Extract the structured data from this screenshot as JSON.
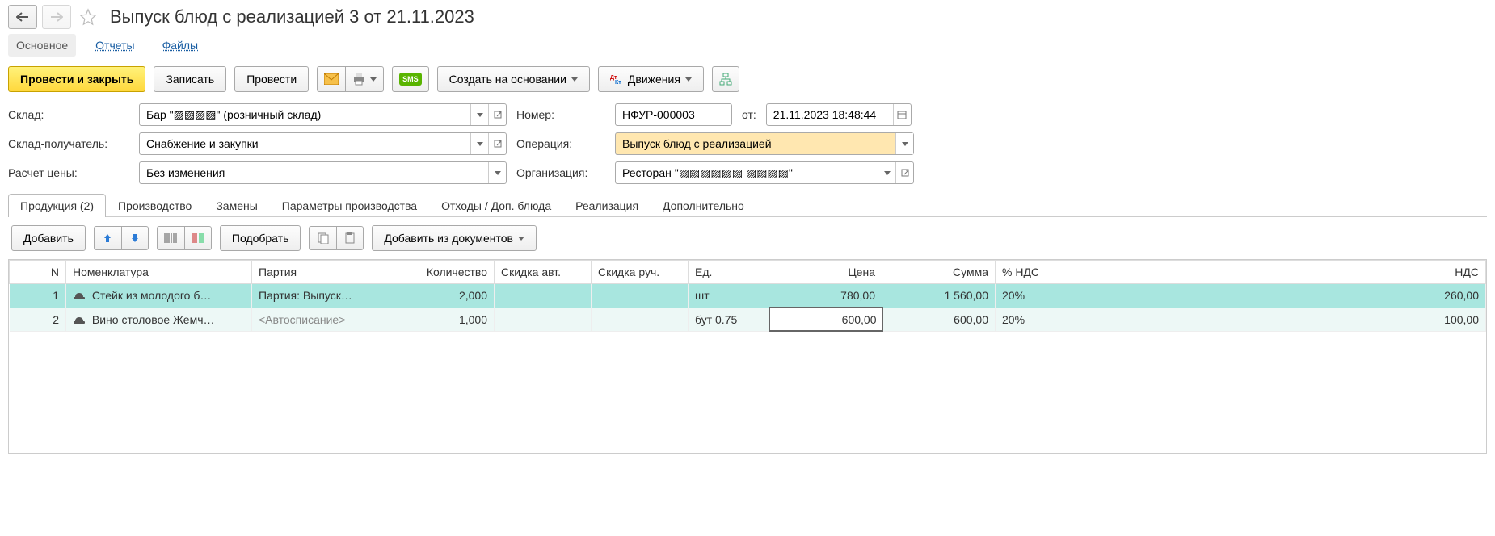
{
  "title": "Выпуск блюд с реализацией 3 от 21.11.2023",
  "nav": {
    "main": "Основное",
    "reports": "Отчеты",
    "files": "Файлы"
  },
  "toolbar": {
    "post_close": "Провести и закрыть",
    "save": "Записать",
    "post": "Провести",
    "create_based": "Создать на основании",
    "movements": "Движения"
  },
  "labels": {
    "warehouse": "Склад:",
    "warehouse_recv": "Склад-получатель:",
    "price_calc": "Расчет цены:",
    "number": "Номер:",
    "from": "от:",
    "operation": "Операция:",
    "organization": "Организация:"
  },
  "fields": {
    "warehouse": "Бар \"▨▨▨▨\" (розничный склад)",
    "warehouse_recv": "Снабжение и закупки",
    "price_calc": "Без изменения",
    "number": "НФУР-000003",
    "date": "21.11.2023 18:48:44",
    "operation": "Выпуск блюд с реализацией",
    "organization": "Ресторан \"▨▨▨▨▨▨ ▨▨▨▨\""
  },
  "tabs": {
    "products": "Продукция (2)",
    "production": "Производство",
    "subs": "Замены",
    "params": "Параметры производства",
    "waste": "Отходы / Доп. блюда",
    "sales": "Реализация",
    "more": "Дополнительно"
  },
  "subtoolbar": {
    "add": "Добавить",
    "pick": "Подобрать",
    "add_from_docs": "Добавить из документов"
  },
  "columns": {
    "n": "N",
    "nomen": "Номенклатура",
    "batch": "Партия",
    "qty": "Количество",
    "disc_auto": "Скидка авт.",
    "disc_man": "Скидка руч.",
    "unit": "Ед.",
    "price": "Цена",
    "sum": "Сумма",
    "vat_pct": "% НДС",
    "vat": "НДС"
  },
  "rows": [
    {
      "n": "1",
      "nomen": "Стейк из молодого б…",
      "batch": "Партия: Выпуск…",
      "qty": "2,000",
      "disc_auto": "",
      "disc_man": "",
      "unit": "шт",
      "price": "780,00",
      "sum": "1 560,00",
      "vat_pct": "20%",
      "vat": "260,00"
    },
    {
      "n": "2",
      "nomen": "Вино столовое Жемч…",
      "batch": "<Автосписание>",
      "qty": "1,000",
      "disc_auto": "",
      "disc_man": "",
      "unit": "бут 0.75",
      "price": "600,00",
      "sum": "600,00",
      "vat_pct": "20%",
      "vat": "100,00"
    }
  ]
}
